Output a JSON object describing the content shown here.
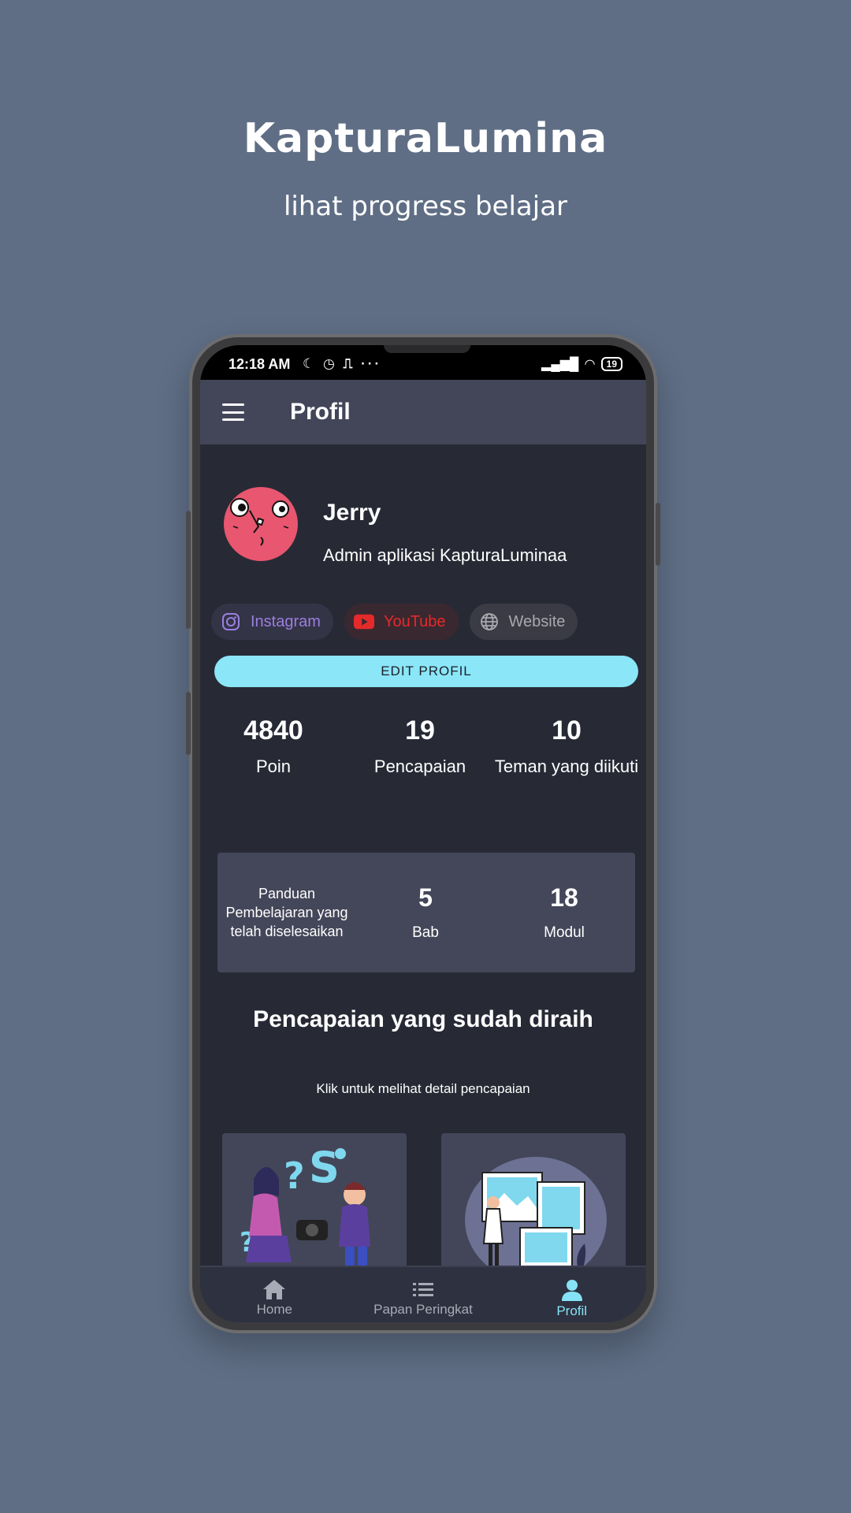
{
  "promo": {
    "title": "KapturaLumina",
    "subtitle": "lihat progress belajar"
  },
  "status_bar": {
    "time": "12:18 AM",
    "icons": "☾ ◷ ⎍  ···",
    "battery": "19"
  },
  "app_bar": {
    "title": "Profil",
    "menu_icon": "hamburger-menu-icon"
  },
  "profile": {
    "name": "Jerry",
    "bio": "Admin aplikasi KapturaLuminaa",
    "avatar_color": "#e85670"
  },
  "social_links": [
    {
      "label": "Instagram",
      "icon": "instagram-icon",
      "color": "#9b7fe0"
    },
    {
      "label": "YouTube",
      "icon": "youtube-icon",
      "color": "#e52a2a"
    },
    {
      "label": "Website",
      "icon": "globe-icon",
      "color": "#a8a8ae"
    }
  ],
  "edit_button": {
    "label": "EDIT PROFIL",
    "color": "#8be6f8"
  },
  "stats": [
    {
      "value": "4840",
      "label": "Poin"
    },
    {
      "value": "19",
      "label": "Pencapaian"
    },
    {
      "value": "10",
      "label": "Teman yang diikuti"
    }
  ],
  "panduan": {
    "text": "Panduan Pembelajaran yang telah diselesaikan",
    "items": [
      {
        "value": "5",
        "label": "Bab"
      },
      {
        "value": "18",
        "label": "Modul"
      }
    ]
  },
  "achievements": {
    "title": "Pencapaian yang sudah diraih",
    "subtitle": "Klik untuk melihat detail pencapaian"
  },
  "bottom_nav": {
    "items": [
      {
        "label": "Home",
        "icon": "home-icon",
        "active": false
      },
      {
        "label": "Papan Peringkat",
        "icon": "list-icon",
        "active": false
      },
      {
        "label": "Profil",
        "icon": "person-icon",
        "active": true
      }
    ],
    "active_color": "#86e3f6"
  }
}
